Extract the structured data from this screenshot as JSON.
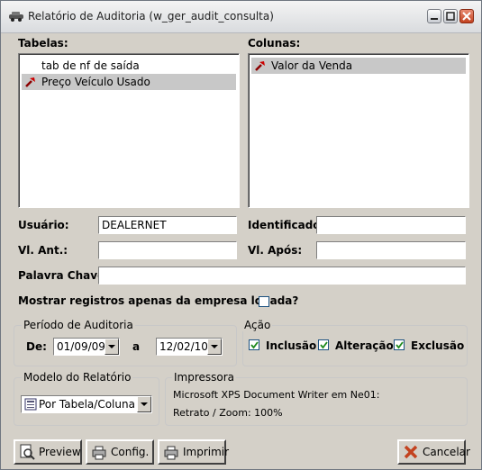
{
  "window": {
    "title": "Relatório de Auditoria (w_ger_audit_consulta)"
  },
  "tabelas": {
    "label": "Tabelas:",
    "items": [
      {
        "label": "tab de nf de saída",
        "selected": false,
        "icon": ""
      },
      {
        "label": "Preço Veículo Usado",
        "selected": true,
        "icon": "hammer-icon"
      }
    ]
  },
  "colunas": {
    "label": "Colunas:",
    "items": [
      {
        "label": "Valor da Venda",
        "selected": true,
        "icon": "hammer-icon"
      }
    ]
  },
  "form": {
    "usuario_label": "Usuário:",
    "usuario_value": "DEALERNET",
    "identificador_label": "Identificador:",
    "identificador_value": "",
    "vl_ant_label": "Vl. Ant.:",
    "vl_ant_value": "",
    "vl_apos_label": "Vl. Após:",
    "vl_apos_value": "",
    "palavra_chave_label": "Palavra Chave:",
    "palavra_chave_value": "",
    "mostrar_label": "Mostrar registros apenas da empresa logada?",
    "mostrar_checked": false
  },
  "periodo": {
    "label": "Período de Auditoria",
    "de_label": "De:",
    "de_value": "01/09/09",
    "a_label": "a",
    "a_value": "12/02/10"
  },
  "acao": {
    "label": "Ação",
    "inclusao_label": "Inclusão",
    "inclusao_checked": true,
    "alteracao_label": "Alteração",
    "alteracao_checked": true,
    "exclusao_label": "Exclusão",
    "exclusao_checked": true
  },
  "modelo": {
    "label": "Modelo do Relatório",
    "value": "Por Tabela/Coluna"
  },
  "impressora": {
    "label": "Impressora",
    "line1": "Microsoft XPS Document Writer em Ne01:",
    "line2": "Retrato / Zoom: 100%"
  },
  "buttons": {
    "preview": "Preview",
    "config": "Config.",
    "imprimir": "Imprimir",
    "cancelar": "Cancelar"
  },
  "colors": {
    "close_red": "#c3421f",
    "check_green": "#1f8a1f",
    "select_gray": "#c8c8c8"
  }
}
